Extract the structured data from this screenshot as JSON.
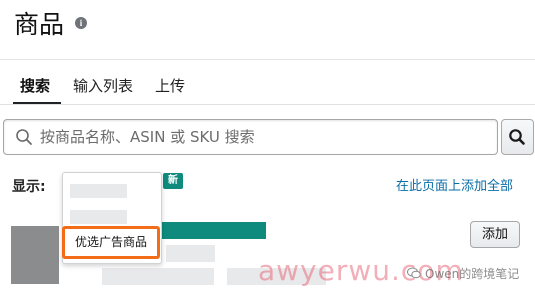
{
  "header": {
    "title": "商品",
    "info_icon": "info-icon"
  },
  "tabs": [
    {
      "label": "搜索",
      "selected": true
    },
    {
      "label": "输入列表",
      "selected": false
    },
    {
      "label": "上传",
      "selected": false
    }
  ],
  "search": {
    "placeholder": "按商品名称、ASIN 或 SKU 搜索",
    "value": "",
    "button_icon": "search-icon"
  },
  "display": {
    "label": "显示:",
    "new_badge": "新",
    "add_all_link": "在此页面上添加全部"
  },
  "dropdown": {
    "highlighted_option": "优选广告商品",
    "highlight_color": "#f36c18"
  },
  "product": {
    "add_button": "添加",
    "accent_color": "#0f8b7d"
  },
  "watermarks": {
    "site": "awyerwu.com",
    "author": "Owen的跨境笔记"
  }
}
